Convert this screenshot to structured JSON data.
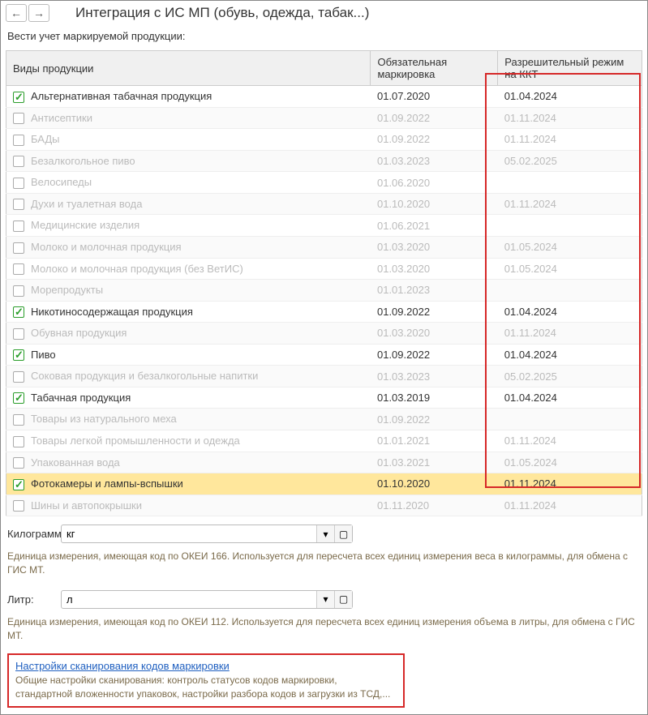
{
  "header": {
    "title": "Интеграция с ИС МП (обувь, одежда, табак...)"
  },
  "subtitle": "Вести учет маркируемой продукции:",
  "columns": {
    "product": "Виды продукции",
    "marking": "Обязательная маркировка",
    "kkt": "Разрешительный режим на ККТ"
  },
  "rows": [
    {
      "name": "Альтернативная табачная продукция",
      "mark": "01.07.2020",
      "kkt": "01.04.2024",
      "checked": true,
      "enabled": true
    },
    {
      "name": "Антисептики",
      "mark": "01.09.2022",
      "kkt": "01.11.2024",
      "checked": false,
      "enabled": false
    },
    {
      "name": "БАДы",
      "mark": "01.09.2022",
      "kkt": "01.11.2024",
      "checked": false,
      "enabled": false
    },
    {
      "name": "Безалкогольное пиво",
      "mark": "01.03.2023",
      "kkt": "05.02.2025",
      "checked": false,
      "enabled": false
    },
    {
      "name": "Велосипеды",
      "mark": "01.06.2020",
      "kkt": "",
      "checked": false,
      "enabled": false
    },
    {
      "name": "Духи и туалетная вода",
      "mark": "01.10.2020",
      "kkt": "01.11.2024",
      "checked": false,
      "enabled": false
    },
    {
      "name": "Медицинские изделия",
      "mark": "01.06.2021",
      "kkt": "",
      "checked": false,
      "enabled": false
    },
    {
      "name": "Молоко и молочная продукция",
      "mark": "01.03.2020",
      "kkt": "01.05.2024",
      "checked": false,
      "enabled": false
    },
    {
      "name": "Молоко и молочная продукция (без ВетИС)",
      "mark": "01.03.2020",
      "kkt": "01.05.2024",
      "checked": false,
      "enabled": false
    },
    {
      "name": "Морепродукты",
      "mark": "01.01.2023",
      "kkt": "",
      "checked": false,
      "enabled": false
    },
    {
      "name": "Никотиносодержащая продукция",
      "mark": "01.09.2022",
      "kkt": "01.04.2024",
      "checked": true,
      "enabled": true
    },
    {
      "name": "Обувная продукция",
      "mark": "01.03.2020",
      "kkt": "01.11.2024",
      "checked": false,
      "enabled": false
    },
    {
      "name": "Пиво",
      "mark": "01.09.2022",
      "kkt": "01.04.2024",
      "checked": true,
      "enabled": true
    },
    {
      "name": "Соковая продукция и безалкогольные напитки",
      "mark": "01.03.2023",
      "kkt": "05.02.2025",
      "checked": false,
      "enabled": false
    },
    {
      "name": "Табачная продукция",
      "mark": "01.03.2019",
      "kkt": "01.04.2024",
      "checked": true,
      "enabled": true
    },
    {
      "name": "Товары из натурального меха",
      "mark": "01.09.2022",
      "kkt": "",
      "checked": false,
      "enabled": false
    },
    {
      "name": "Товары легкой промышленности и одежда",
      "mark": "01.01.2021",
      "kkt": "01.11.2024",
      "checked": false,
      "enabled": false
    },
    {
      "name": "Упакованная вода",
      "mark": "01.03.2021",
      "kkt": "01.05.2024",
      "checked": false,
      "enabled": false
    },
    {
      "name": "Фотокамеры и лампы-вспышки",
      "mark": "01.10.2020",
      "kkt": "01.11.2024",
      "checked": true,
      "enabled": true,
      "selected": true
    },
    {
      "name": "Шины и автопокрышки",
      "mark": "01.11.2020",
      "kkt": "01.11.2024",
      "checked": false,
      "enabled": false
    }
  ],
  "kilogram": {
    "label": "Килограмм:",
    "value": "кг",
    "hint": "Единица измерения, имеющая код по ОКЕИ 166. Используется для пересчета всех единиц измерения веса в килограммы, для обмена с ГИС МТ."
  },
  "liter": {
    "label": "Литр:",
    "value": "л",
    "hint": "Единица измерения, имеющая код по ОКЕИ 112. Используется для пересчета всех единиц измерения объема в литры, для обмена с ГИС МТ."
  },
  "settings": {
    "link": "Настройки сканирования кодов маркировки",
    "desc": "Общие настройки сканирования: контроль статусов кодов маркировки, стандартной вложенности упаковок, настройки разбора кодов и загрузки из ТСД,..."
  }
}
